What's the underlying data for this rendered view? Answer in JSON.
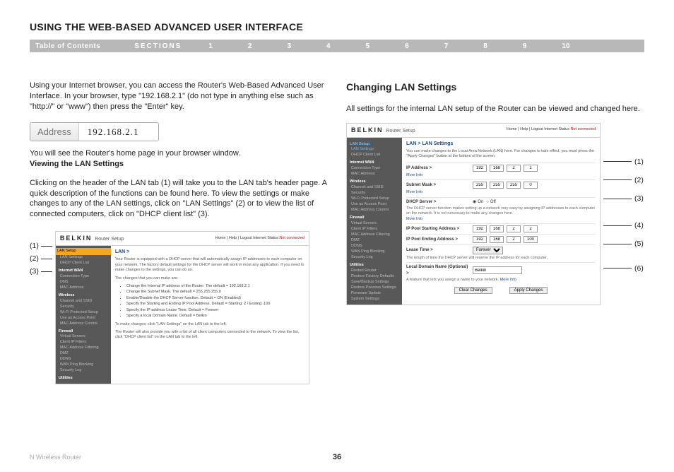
{
  "page_title": "USING THE WEB-BASED ADVANCED USER INTERFACE",
  "nav": {
    "toc": "Table of Contents",
    "sections": "SECTIONS",
    "numbers": [
      "1",
      "2",
      "3",
      "4",
      "5",
      "6",
      "7",
      "8",
      "9",
      "10"
    ],
    "current": "6"
  },
  "left": {
    "intro": "Using your Internet browser, you can access the Router's Web-Based Advanced User Interface. In your browser, type \"192.168.2.1\" (do not type in anything else such as \"http://\" or \"www\") then press the \"Enter\" key.",
    "address_label": "Address",
    "address_value": "192.168.2.1",
    "homeline": "You will see the Router's home page in your browser window.",
    "subhead": "Viewing the LAN Settings",
    "para2": "Clicking on the header of the LAN tab (1) will take you to the LAN tab's header page. A quick description of the functions can be found here. To view the settings or make changes to any of the LAN settings, click on \"LAN Settings\" (2) or to view the list of connected computers, click on \"DHCP client list\" (3).",
    "callouts": [
      "(1)",
      "(2)",
      "(3)"
    ],
    "shot": {
      "brand": "BELKIN",
      "setup": "Router Setup",
      "header_links": "Home | Help | Logout   Internet Status",
      "status": "Not connected",
      "sidebar": {
        "cat1": "LAN Setup",
        "items1": [
          "LAN Settings",
          "DHCP Client List"
        ],
        "cat2": "Internet WAN",
        "items2": [
          "Connection Type",
          "DNS",
          "MAC Address"
        ],
        "cat3": "Wireless",
        "items3": [
          "Channel and SSID",
          "Security",
          "Wi-Fi Protected Setup",
          "Use as Access Point",
          "MAC Address Control"
        ],
        "cat4": "Firewall",
        "items4": [
          "Virtual Servers",
          "Client IP Filters",
          "MAC Address Filtering",
          "DMZ",
          "DDNS",
          "WAN Ping Blocking",
          "Security Log"
        ],
        "cat5": "Utilities"
      },
      "main": {
        "title": "LAN >",
        "desc": "Your Router is equipped with a DHCP server that will automatically assign IP addresses to each computer on your network. The factory default settings for the DHCP server will work in most any application. If you need to make changes to the settings, you can do so.",
        "changes_label": "The changes that you can make are:",
        "bullets": [
          "Change the Internal IP address of the Router. The default = 192.168.2.1",
          "Change the Subnet Mask. The default = 255.255.255.0",
          "Enable/Disable the DHCP Server function. Default = ON (Enabled)",
          "Specify the Starting and Ending IP Pool Address. Default = Starting: 2 / Ending: 100",
          "Specify the IP address Lease Time. Default = Forever",
          "Specify a local Domain Name. Default = Belkin"
        ],
        "note1": "To make changes, click \"LAN Settings\" on the LAN tab to the left.",
        "note2": "The Router will also provide you with a list of all client computers connected to the network. To view the list, click \"DHCP client list\" on the LAN tab to the left."
      }
    }
  },
  "right": {
    "heading": "Changing LAN Settings",
    "intro": "All settings for the internal LAN setup of the Router can be viewed and changed here.",
    "callouts": [
      "(1)",
      "(2)",
      "(3)",
      "(4)",
      "(5)",
      "(6)"
    ],
    "shot": {
      "brand": "BELKIN",
      "setup": "Router Setup",
      "header_links": "Home | Help | Logout   Internet Status",
      "status": "Not connected",
      "title": "LAN > LAN Settings",
      "desc": "You can make changes to the Local Area Network (LAN) here. For changes to take effect, you must press the \"Apply Changes\" button at the bottom of the screen.",
      "more_info": "More Info",
      "fields": {
        "ip_label": "IP Address >",
        "ip": [
          "192",
          "168",
          "2",
          "1"
        ],
        "subnet_label": "Subnet Mask >",
        "subnet": [
          "255",
          "255",
          "255",
          "0"
        ],
        "dhcp_label": "DHCP Server >",
        "dhcp_on": "On",
        "dhcp_off": "Off",
        "dhcp_desc": "The DHCP server function makes setting up a network very easy by assigning IP addresses to each computer on the network. It is not necessary to make any changes here.",
        "pool_start_label": "IP Pool Starting Address >",
        "pool_start": [
          "192",
          "168",
          "2",
          "2"
        ],
        "pool_end_label": "IP Pool Ending Address >",
        "pool_end": [
          "192",
          "168",
          "2",
          "100"
        ],
        "lease_label": "Lease Time >",
        "lease_value": "Forever",
        "lease_desc": "The length of time the DHCP server will reserve the IP address for each computer.",
        "domain_label": "Local Domain Name  (Optional) >",
        "domain_value": "Belkin",
        "domain_desc": "A feature that lets you assign a name to your network.",
        "btn_clear": "Clear Changes",
        "btn_apply": "Apply Changes"
      }
    }
  },
  "footer": {
    "product": "N Wireless Router",
    "page": "36"
  }
}
